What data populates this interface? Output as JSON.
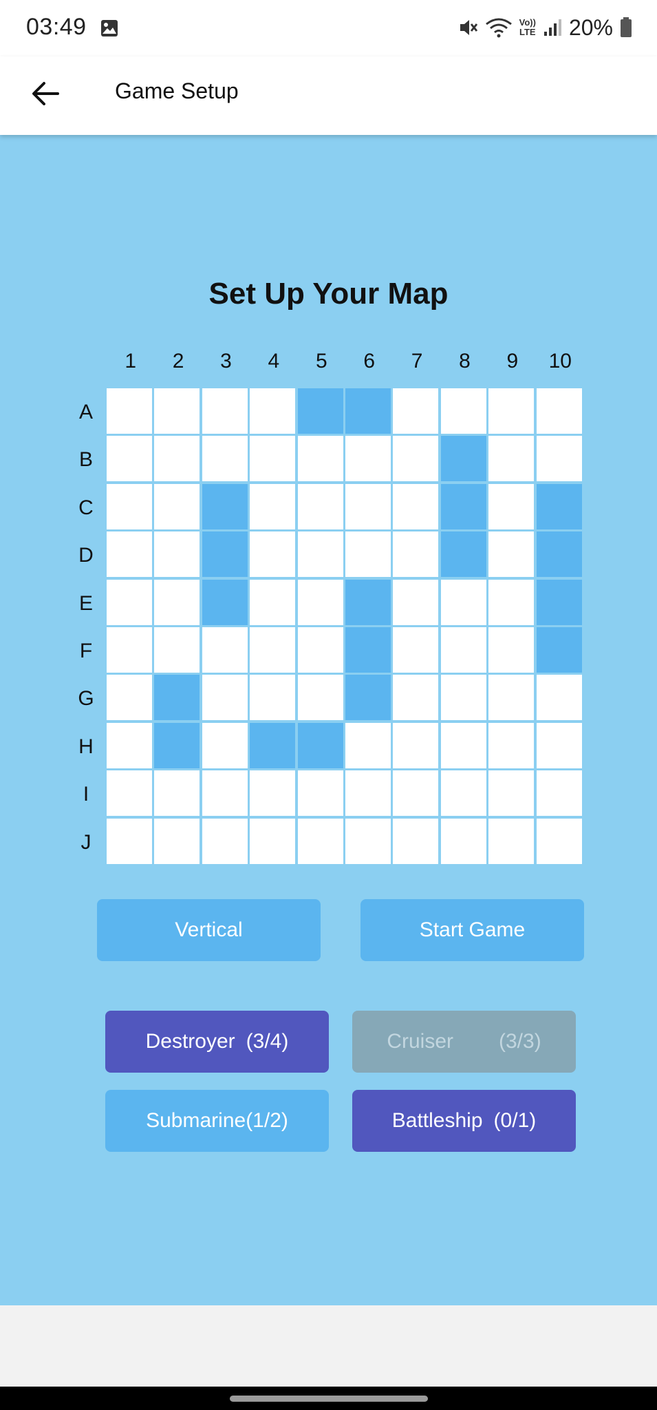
{
  "status_bar": {
    "time": "03:49",
    "battery": "20%",
    "icons": [
      "gallery-icon",
      "mute-icon",
      "wifi-icon",
      "volte-icon",
      "signal-icon",
      "battery-icon"
    ],
    "volte_label_top": "Vo))",
    "volte_label_bottom": "LTE"
  },
  "app_bar": {
    "title": "Game Setup",
    "back_icon": "arrow-left-icon"
  },
  "main": {
    "heading": "Set Up Your Map",
    "background_color": "#8bcff1"
  },
  "board": {
    "columns": [
      "1",
      "2",
      "3",
      "4",
      "5",
      "6",
      "7",
      "8",
      "9",
      "10"
    ],
    "rows": [
      "A",
      "B",
      "C",
      "D",
      "E",
      "F",
      "G",
      "H",
      "I",
      "J"
    ],
    "ship_color": "#5bb5ef",
    "empty_color": "#ffffff",
    "ship_cells": [
      "A5",
      "A6",
      "B8",
      "C3",
      "C8",
      "C10",
      "D3",
      "D8",
      "D10",
      "E3",
      "E6",
      "E10",
      "F6",
      "F10",
      "G2",
      "G6",
      "H2",
      "H4",
      "H5"
    ]
  },
  "controls": {
    "orientation_label": "Vertical",
    "start_label": "Start Game"
  },
  "ships": {
    "destroyer": {
      "name": "Destroyer",
      "count": "(3/4)",
      "state": "available"
    },
    "cruiser": {
      "name": "Cruiser",
      "count": "(3/3)",
      "state": "disabled"
    },
    "submarine": {
      "label": "Submarine(1/2)",
      "state": "selected"
    },
    "battleship": {
      "name": "Battleship",
      "count": "(0/1)",
      "state": "available"
    }
  },
  "colors": {
    "accent_light": "#5bb5ef",
    "accent_dark": "#5157be",
    "disabled": "#86a8b7"
  }
}
